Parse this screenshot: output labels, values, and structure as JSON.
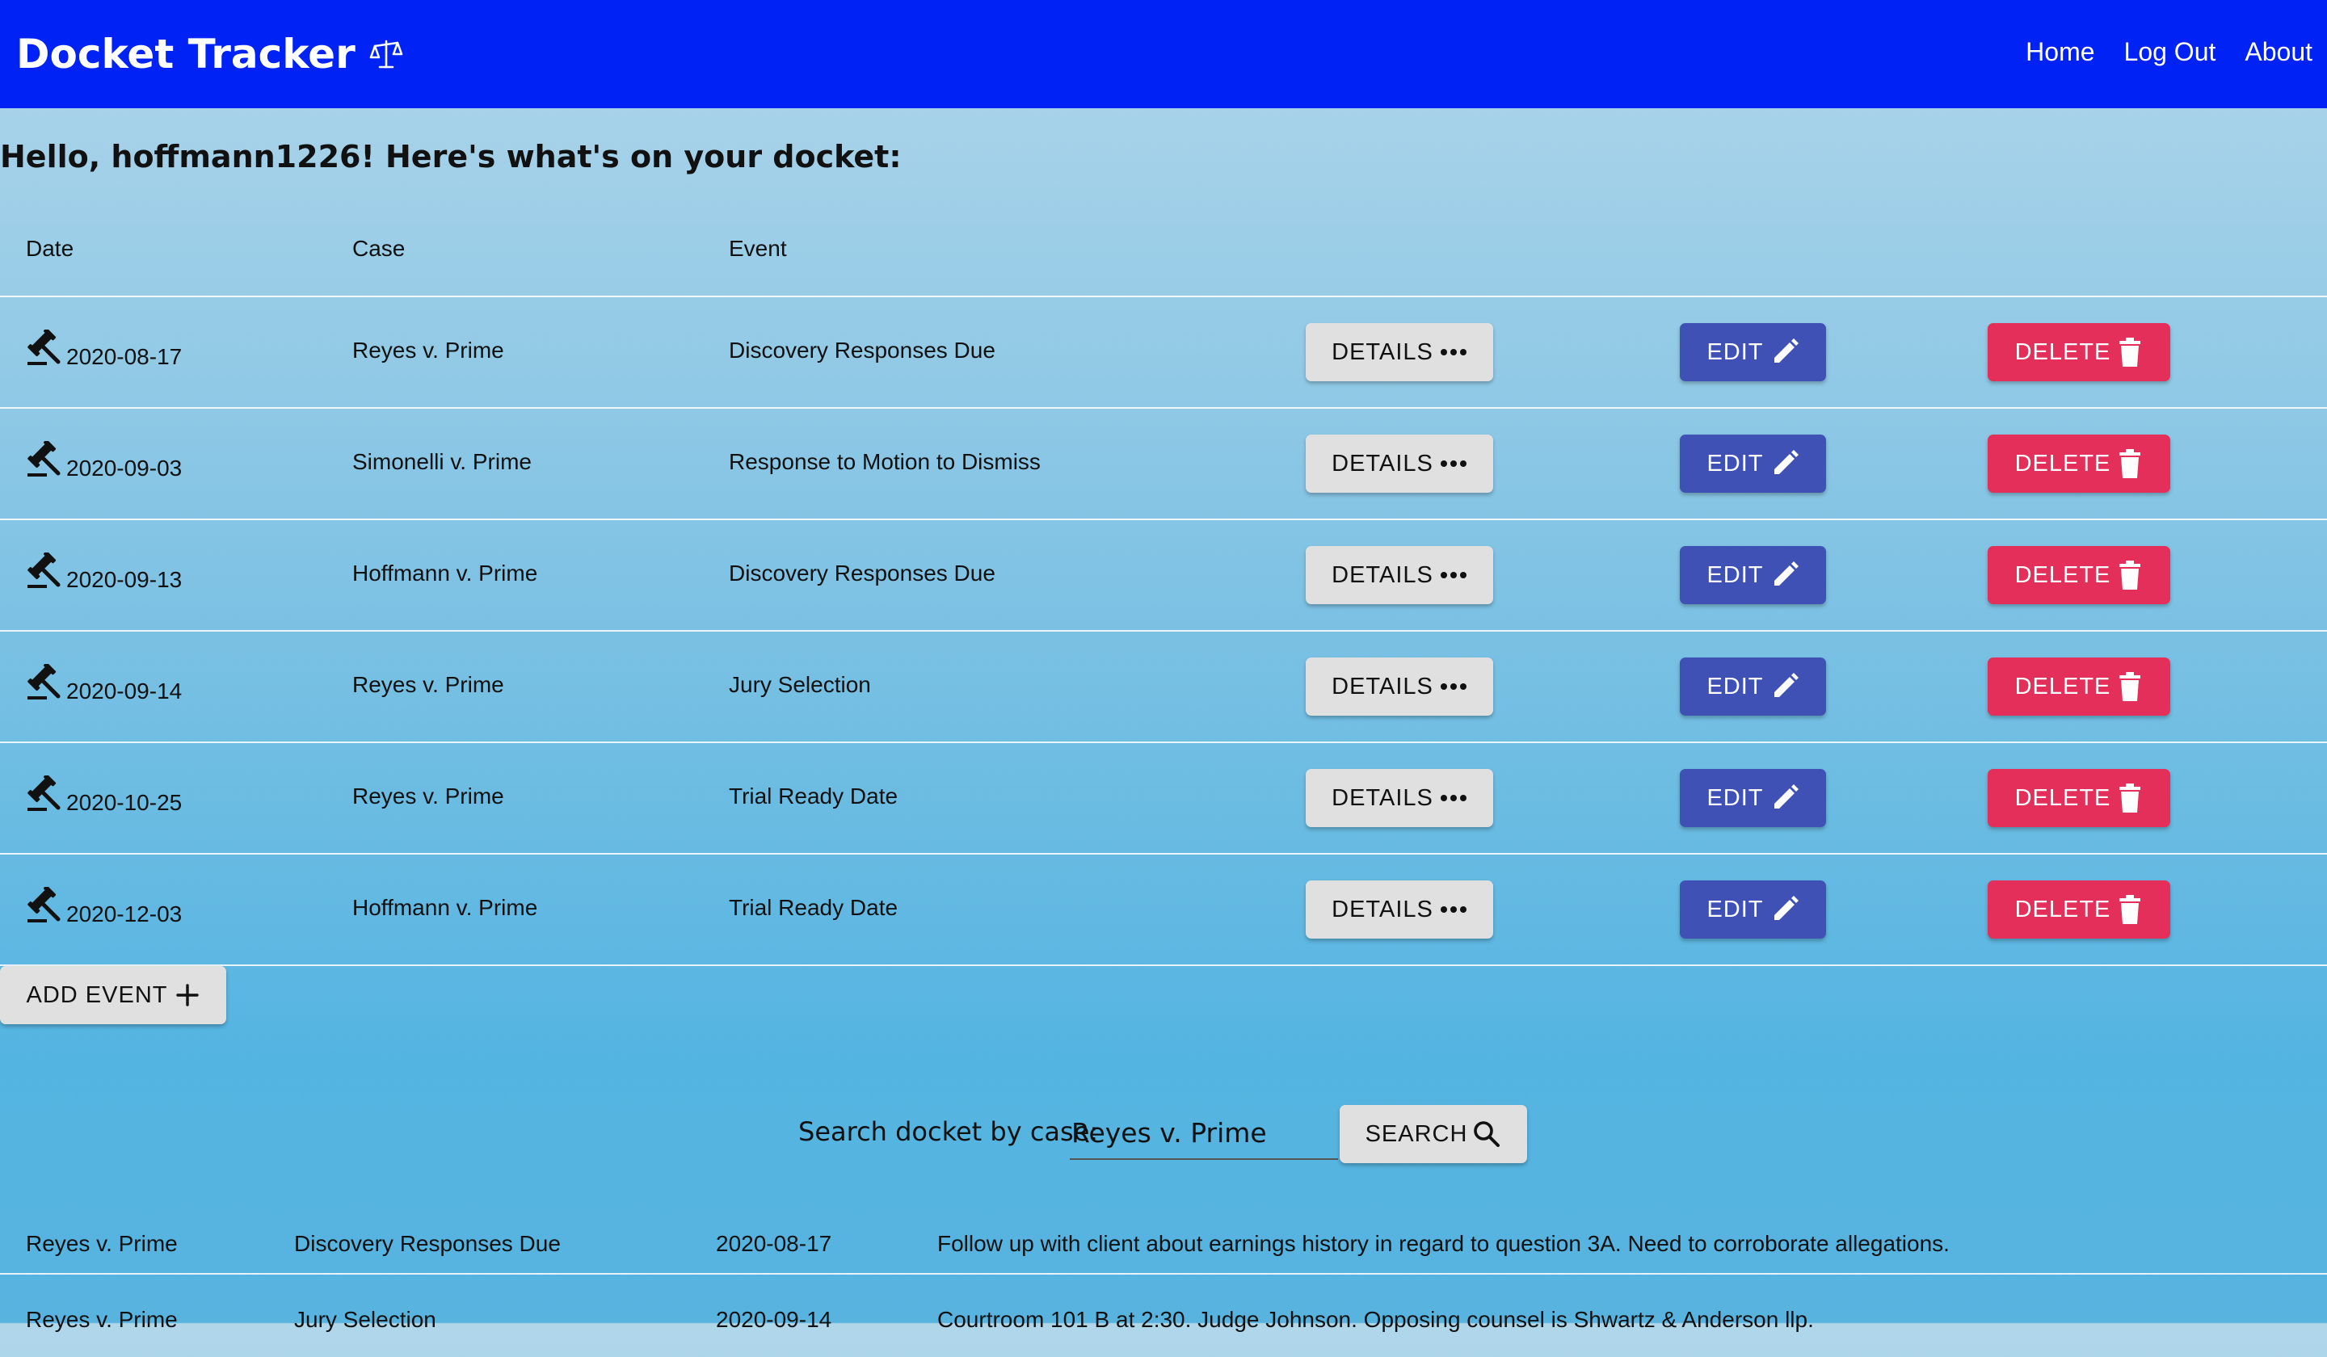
{
  "navbar": {
    "brand": "Docket Tracker",
    "links": [
      "Home",
      "Log Out",
      "About"
    ]
  },
  "greeting": "Hello, hoffmann1226! Here's what's on your docket:",
  "table": {
    "headers": [
      "Date",
      "Case",
      "Event"
    ],
    "rows": [
      {
        "date": "2020-08-17",
        "case": "Reyes v. Prime",
        "event": "Discovery Responses Due"
      },
      {
        "date": "2020-09-03",
        "case": "Simonelli v. Prime",
        "event": "Response to Motion to Dismiss"
      },
      {
        "date": "2020-09-13",
        "case": "Hoffmann v. Prime",
        "event": "Discovery Responses Due"
      },
      {
        "date": "2020-09-14",
        "case": "Reyes v. Prime",
        "event": "Jury Selection"
      },
      {
        "date": "2020-10-25",
        "case": "Reyes v. Prime",
        "event": "Trial Ready Date"
      },
      {
        "date": "2020-12-03",
        "case": "Hoffmann v. Prime",
        "event": "Trial Ready Date"
      }
    ],
    "buttons": {
      "details": "DETAILS",
      "edit": "EDIT",
      "delete": "DELETE"
    }
  },
  "add_event_label": "ADD EVENT",
  "search": {
    "label": "Search docket by case:",
    "value": "Reyes v. Prime",
    "button": "SEARCH"
  },
  "results": [
    {
      "case": "Reyes v. Prime",
      "event": "Discovery Responses Due",
      "date": "2020-08-17",
      "details": "Follow up with client about earnings history in regard to question 3A. Need to corroborate allegations."
    },
    {
      "case": "Reyes v. Prime",
      "event": "Jury Selection",
      "date": "2020-09-14",
      "details": "Courtroom 101 B at 2:30. Judge Johnson. Opposing counsel is Shwartz & Anderson llp."
    }
  ],
  "icons": {
    "brand": "scales-icon",
    "row": "gavel-icon",
    "details": "more-horiz-icon",
    "edit": "pencil-icon",
    "delete": "trash-icon",
    "add": "plus-icon",
    "search": "magnifier-icon"
  },
  "colors": {
    "navbar": "#0022f5",
    "edit": "#3f51b5",
    "delete": "#e42f5a",
    "default_button": "#e0e0e0"
  }
}
